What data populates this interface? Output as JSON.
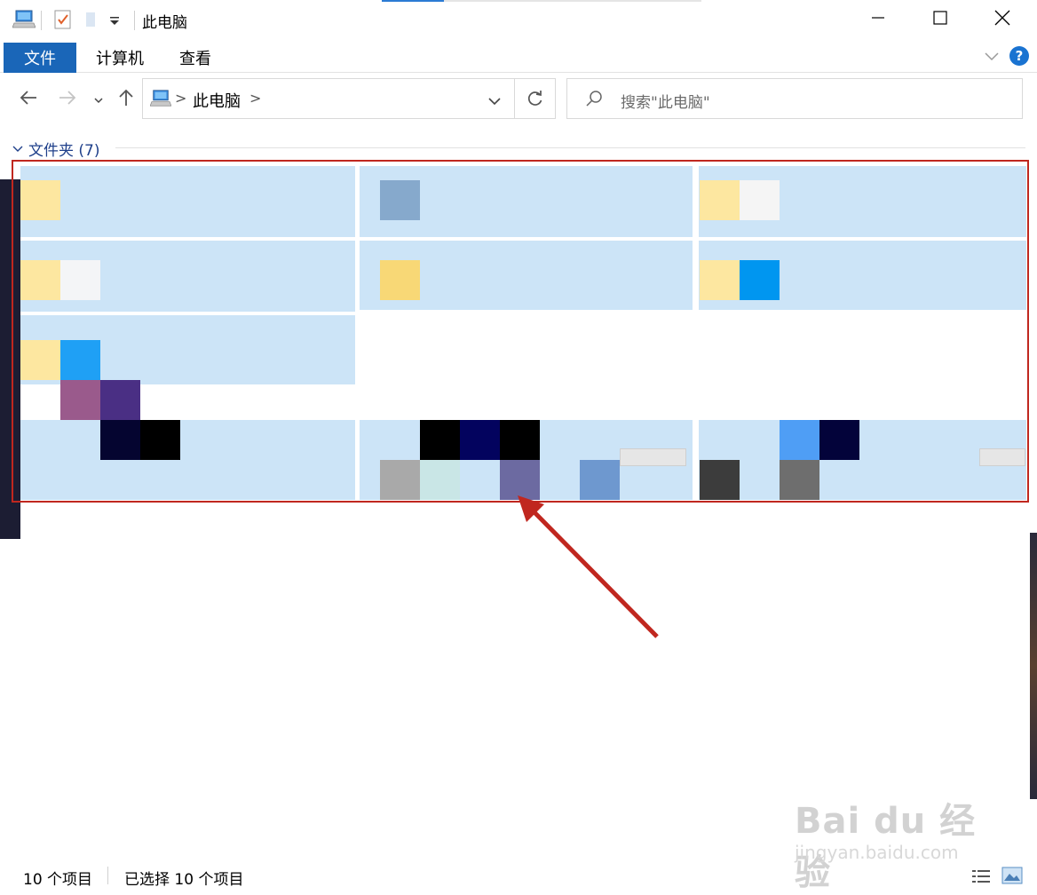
{
  "window": {
    "title": "此电脑",
    "accent_color": "#1a66b8"
  },
  "ribbon": {
    "tabs": [
      {
        "label": "文件",
        "active": true
      },
      {
        "label": "计算机",
        "active": false
      },
      {
        "label": "查看",
        "active": false
      }
    ],
    "help_label": "?"
  },
  "address": {
    "path": "此电脑",
    "separator": ">"
  },
  "search": {
    "placeholder": "搜索\"此电脑\""
  },
  "group": {
    "label": "文件夹 (7)"
  },
  "selection": {
    "highlight_color": "#cce4f7",
    "box_color": "#c0271f"
  },
  "status": {
    "item_count": "10 个项目",
    "selected_count": "已选择 10 个项目"
  },
  "watermark": {
    "logo_text": "Bai du 经验",
    "url": "jingyan.baidu.com"
  },
  "icons": [
    "computer-icon",
    "properties-icon",
    "new-folder-icon",
    "quick-access-dropdown-icon",
    "minimize-icon",
    "maximize-icon",
    "close-icon",
    "back-icon",
    "forward-icon",
    "recent-dropdown-icon",
    "up-icon",
    "refresh-icon",
    "search-icon",
    "details-view-icon",
    "large-icons-view-icon"
  ]
}
